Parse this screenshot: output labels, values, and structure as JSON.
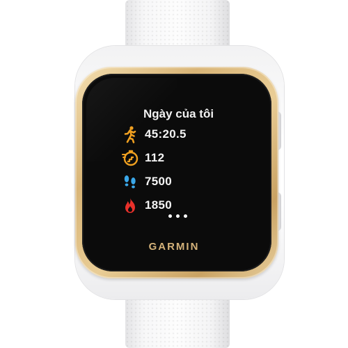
{
  "watch": {
    "brand": "GARMIN",
    "case_color": "#d9b577",
    "strap_color": "#f7f7f8"
  },
  "screen": {
    "title": "Ngày của tôi",
    "metrics": [
      {
        "icon": "walking-person-icon",
        "value": "45:20.5",
        "color": "#f0a020"
      },
      {
        "icon": "stairs-target-icon",
        "value": "112",
        "color": "#f0a020"
      },
      {
        "icon": "footsteps-icon",
        "value": "7500",
        "color": "#3aa7e8"
      },
      {
        "icon": "flame-icon",
        "value": "1850",
        "color": "#e8302a"
      }
    ],
    "more_indicator": "more-dots-icon"
  }
}
